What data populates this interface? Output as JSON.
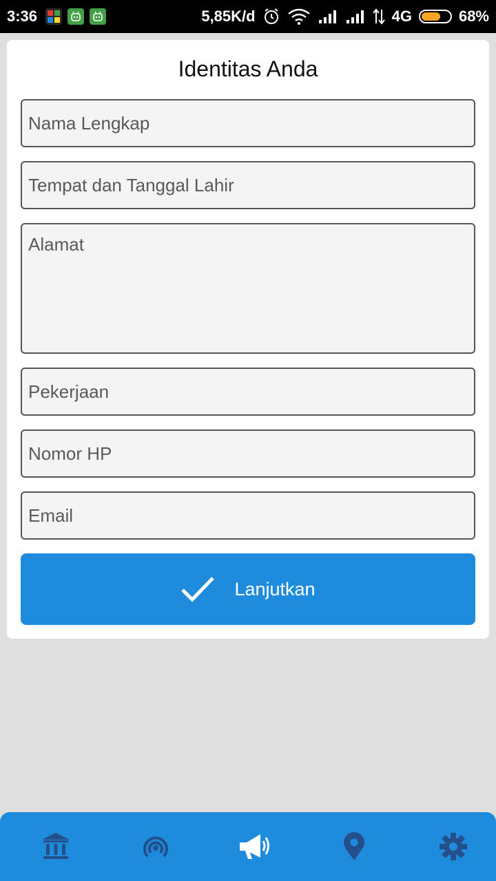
{
  "status_bar": {
    "time": "3:36",
    "net_speed": "5,85K/d",
    "network_type": "4G",
    "battery_percent": "68%",
    "battery_level": 0.68
  },
  "form": {
    "title": "Identitas Anda",
    "fields": {
      "full_name": {
        "placeholder": "Nama Lengkap",
        "value": ""
      },
      "birth_place_date": {
        "placeholder": "Tempat dan Tanggal Lahir",
        "value": ""
      },
      "address": {
        "placeholder": "Alamat",
        "value": ""
      },
      "occupation": {
        "placeholder": "Pekerjaan",
        "value": ""
      },
      "phone": {
        "placeholder": "Nomor HP",
        "value": ""
      },
      "email": {
        "placeholder": "Email",
        "value": ""
      }
    },
    "submit_label": "Lanjutkan"
  },
  "bottom_nav": {
    "items": [
      {
        "icon": "bank-icon",
        "active": false
      },
      {
        "icon": "broadcast-icon",
        "active": false
      },
      {
        "icon": "megaphone-icon",
        "active": true
      },
      {
        "icon": "map-pin-icon",
        "active": false
      },
      {
        "icon": "gear-icon",
        "active": false
      }
    ]
  },
  "colors": {
    "accent": "#1e8bdc",
    "nav_inactive": "#23508a",
    "nav_active": "#ffffff"
  }
}
